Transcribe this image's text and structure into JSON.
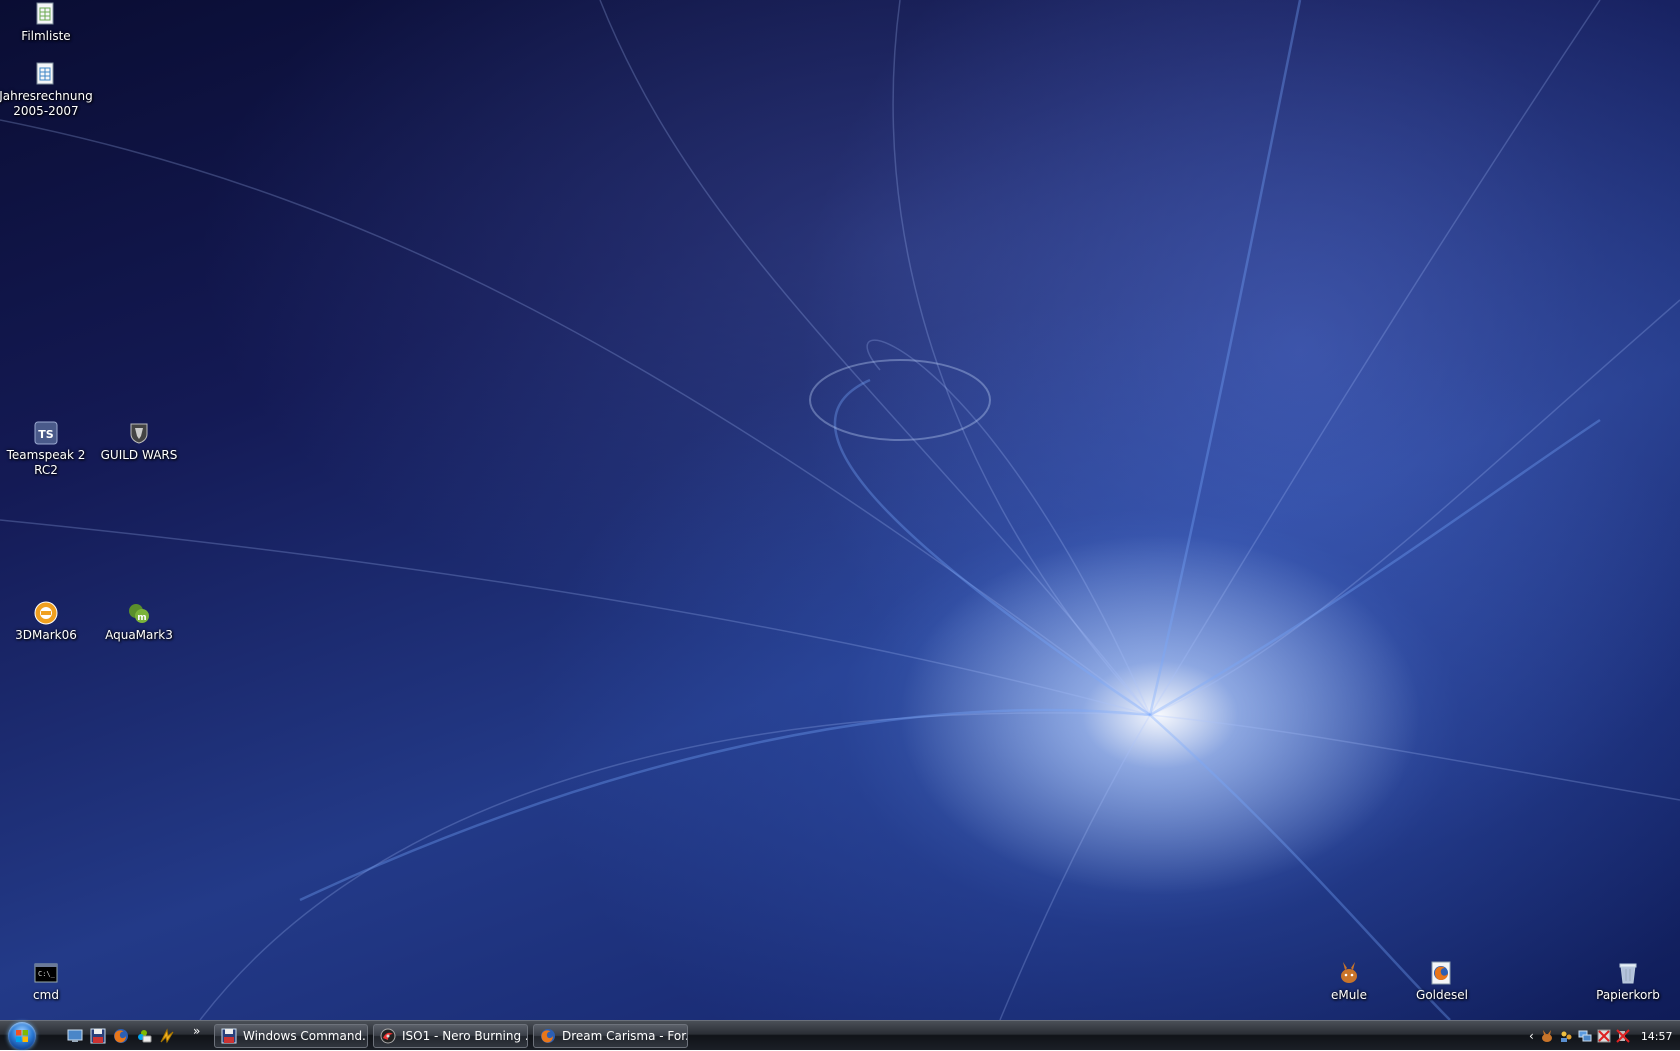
{
  "desktop": {
    "icons": [
      {
        "label": "Filmliste"
      },
      {
        "label": "Jahresrechnung\n2005-2007"
      },
      {
        "label": "Teamspeak 2\nRC2"
      },
      {
        "label": "GUILD WARS"
      },
      {
        "label": "3DMark06"
      },
      {
        "label": "AquaMark3"
      },
      {
        "label": "cmd"
      },
      {
        "label": "eMule"
      },
      {
        "label": "Goldesel"
      },
      {
        "label": "Papierkorb"
      }
    ]
  },
  "taskbar": {
    "quick_launch_more": "»",
    "buttons": [
      {
        "label": "Windows Command..."
      },
      {
        "label": "ISO1 - Nero Burning ..."
      },
      {
        "label": "Dream Carisma - For..."
      }
    ],
    "tray": {
      "chevron": "‹",
      "clock": "14:57"
    }
  },
  "colors": {
    "icon_label": "#ffffff",
    "taskbar_bg": "#1b1f26",
    "accent": "#2b7bd6"
  }
}
